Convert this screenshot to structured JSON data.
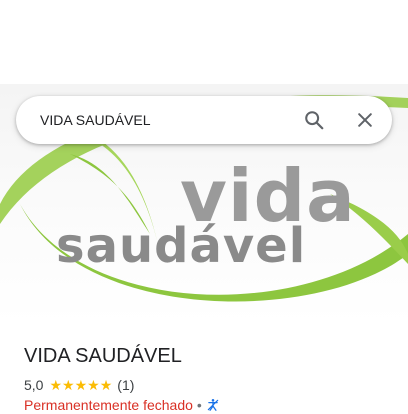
{
  "search": {
    "query": "VIDA SAUDÁVEL"
  },
  "hero": {
    "logo_line1": "vida",
    "logo_line2": "saudável",
    "swoosh_color": "#8dc63f"
  },
  "place": {
    "name": "VIDA SAUDÁVEL",
    "rating": "5,0",
    "stars": 5,
    "review_count": "(1)",
    "status": "Permanentemente fechado",
    "separator": "•",
    "status_icon": "accessibility-icon"
  },
  "colors": {
    "star": "#fbbc04",
    "status_closed": "#d93025",
    "accessibility": "#1a73e8"
  }
}
